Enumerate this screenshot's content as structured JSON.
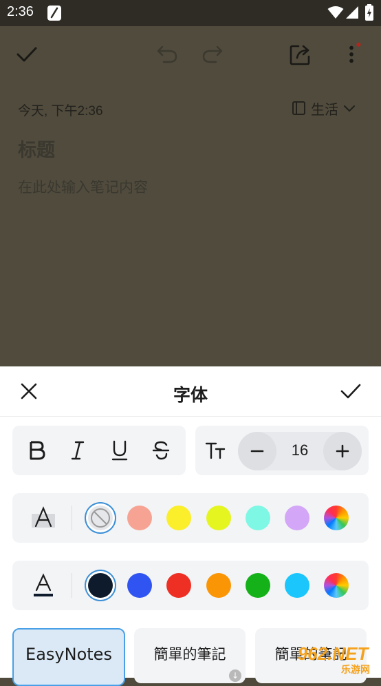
{
  "status_bar": {
    "time": "2:36"
  },
  "note": {
    "date": "今天, 下午2:36",
    "category": "生活",
    "title_placeholder": "标题",
    "body_placeholder": "在此处输入笔记内容"
  },
  "font_sheet": {
    "title": "字体",
    "font_size": "16",
    "highlight_colors": [
      "none",
      "#f7a393",
      "#fbee2a",
      "#e5f520",
      "#7ef7e4",
      "#d3a6f7",
      "rainbow"
    ],
    "text_colors": [
      "#0d1b2d",
      "#2f54f1",
      "#ee3024",
      "#fa9606",
      "#15b119",
      "#1ac6fb",
      "rainbow"
    ],
    "fonts": [
      {
        "label": "EasyNotes",
        "selected": true
      },
      {
        "label": "簡單的筆記",
        "selected": false
      },
      {
        "label": "簡單的筆記",
        "selected": false
      }
    ]
  },
  "watermark": {
    "text": "962.NET",
    "sub": "乐游网"
  }
}
